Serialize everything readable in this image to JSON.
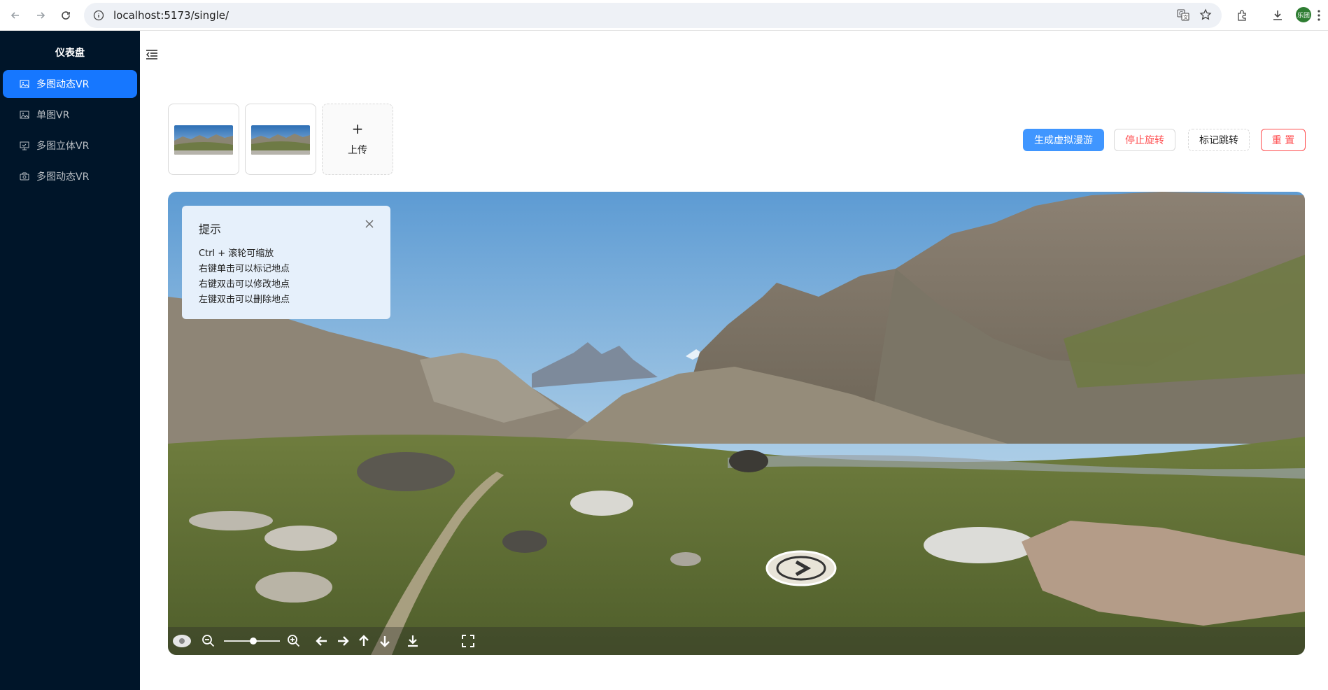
{
  "browser": {
    "url": "localhost:5173/single/",
    "avatar_text": "乐团"
  },
  "sidebar": {
    "title": "仪表盘",
    "items": [
      {
        "label": "多图动态VR",
        "icon": "picture-icon",
        "selected": true
      },
      {
        "label": "单图VR",
        "icon": "picture-icon",
        "selected": false
      },
      {
        "label": "多图立体VR",
        "icon": "monitor-icon",
        "selected": false
      },
      {
        "label": "多图动态VR",
        "icon": "camera-icon",
        "selected": false
      }
    ]
  },
  "uploads": {
    "thumbnails": [
      "panorama-1",
      "panorama-2"
    ],
    "upload_label": "上传",
    "upload_icon": "+"
  },
  "actions": {
    "generate": "生成虚拟漫游",
    "stop_rotate": "停止旋转",
    "mark_jump": "标记跳转",
    "reset": "重 置"
  },
  "tip": {
    "title": "提示",
    "lines": [
      "Ctrl + 滚轮可缩放",
      "右键单击可以标记地点",
      "右键双击可以修改地点",
      "左键双击可以删除地点"
    ]
  },
  "viewer": {
    "toolbar_icons": [
      "eye-icon",
      "zoom-out-icon",
      "zoom-in-icon",
      "arrow-left-icon",
      "arrow-right-icon",
      "arrow-up-icon",
      "arrow-down-icon",
      "download-icon",
      "fullscreen-icon"
    ],
    "hotspot_icon": "chevron-right-icon"
  },
  "colors": {
    "sidebar_bg": "#001529",
    "primary": "#1677ff",
    "danger": "#ff4d4f"
  }
}
